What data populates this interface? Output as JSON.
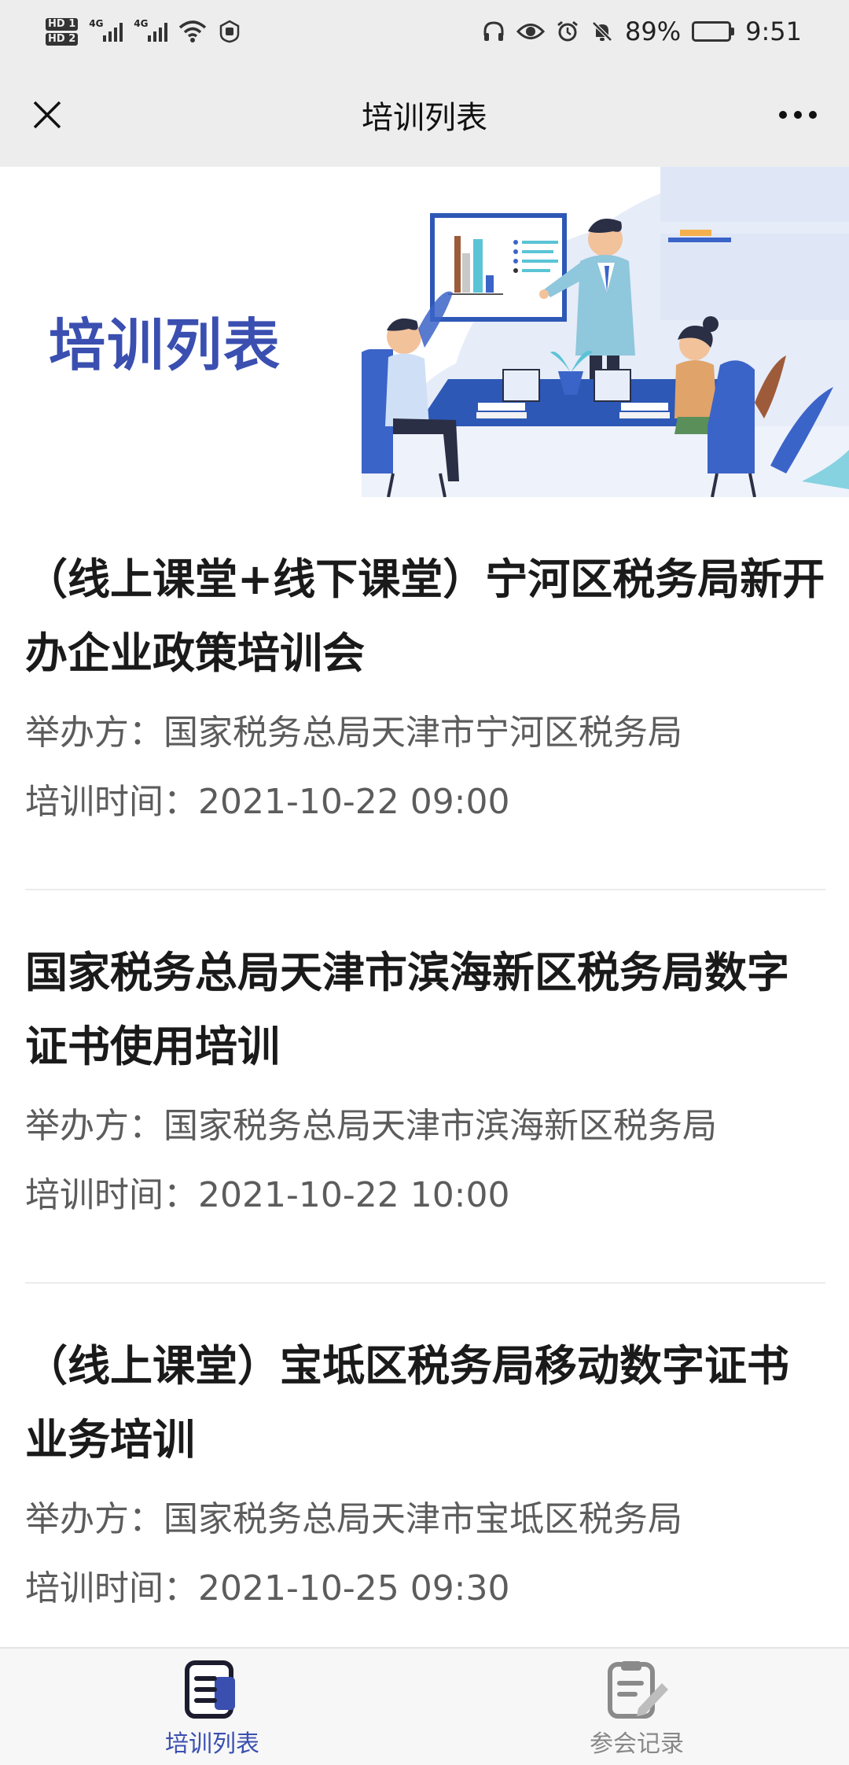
{
  "status_bar": {
    "hd1": "HD 1",
    "hd2": "HD 2",
    "net1": "4G",
    "net2": "4G",
    "battery_percent": "89%",
    "battery_level": 0.89,
    "time": "9:51"
  },
  "nav": {
    "title": "培训列表"
  },
  "banner": {
    "title": "培训列表"
  },
  "list": {
    "organizer_label": "举办方：",
    "time_label": "培训时间：",
    "items": [
      {
        "title": "（线上课堂+线下课堂）宁河区税务局新开办企业政策培训会",
        "organizer": "国家税务总局天津市宁河区税务局",
        "time": "2021-10-22 09:00"
      },
      {
        "title": "国家税务总局天津市滨海新区税务局数字证书使用培训",
        "organizer": "国家税务总局天津市滨海新区税务局",
        "time": "2021-10-22 10:00"
      },
      {
        "title": "（线上课堂）宝坻区税务局移动数字证书业务培训",
        "organizer": "国家税务总局天津市宝坻区税务局",
        "time": "2021-10-25 09:30"
      }
    ]
  },
  "tabbar": {
    "tabs": [
      {
        "label": "培训列表",
        "icon": "document-list-icon",
        "active": true
      },
      {
        "label": "参会记录",
        "icon": "record-edit-icon",
        "active": false
      }
    ]
  },
  "colors": {
    "accent": "#3a4fb0",
    "bar_bg": "#ededed"
  }
}
